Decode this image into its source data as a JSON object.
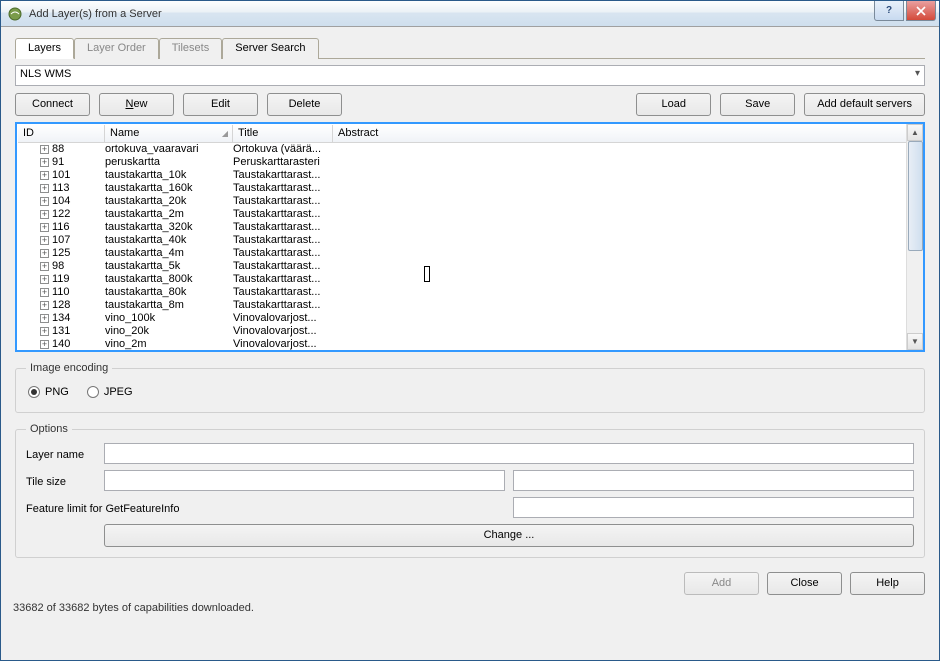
{
  "window": {
    "title": "Add Layer(s) from a Server"
  },
  "tabs": [
    {
      "label": "Layers",
      "active": true,
      "disabled": false
    },
    {
      "label": "Layer Order",
      "active": false,
      "disabled": true
    },
    {
      "label": "Tilesets",
      "active": false,
      "disabled": true
    },
    {
      "label": "Server Search",
      "active": false,
      "disabled": false
    }
  ],
  "server_dropdown": {
    "value": "NLS WMS"
  },
  "buttons": {
    "connect": "Connect",
    "new": "New",
    "edit": "Edit",
    "delete": "Delete",
    "load": "Load",
    "save": "Save",
    "add_default": "Add default servers",
    "add": "Add",
    "close": "Close",
    "help": "Help",
    "change": "Change ..."
  },
  "columns": {
    "id": "ID",
    "name": "Name",
    "title": "Title",
    "abstract": "Abstract"
  },
  "rows": [
    {
      "id": "88",
      "name": "ortokuva_vaaravari",
      "title": "Ortokuva (väärä..."
    },
    {
      "id": "91",
      "name": "peruskartta",
      "title": "Peruskarttarasteri"
    },
    {
      "id": "101",
      "name": "taustakartta_10k",
      "title": "Taustakarttarast..."
    },
    {
      "id": "113",
      "name": "taustakartta_160k",
      "title": "Taustakarttarast..."
    },
    {
      "id": "104",
      "name": "taustakartta_20k",
      "title": "Taustakarttarast..."
    },
    {
      "id": "122",
      "name": "taustakartta_2m",
      "title": "Taustakarttarast..."
    },
    {
      "id": "116",
      "name": "taustakartta_320k",
      "title": "Taustakarttarast..."
    },
    {
      "id": "107",
      "name": "taustakartta_40k",
      "title": "Taustakarttarast..."
    },
    {
      "id": "125",
      "name": "taustakartta_4m",
      "title": "Taustakarttarast..."
    },
    {
      "id": "98",
      "name": "taustakartta_5k",
      "title": "Taustakarttarast..."
    },
    {
      "id": "119",
      "name": "taustakartta_800k",
      "title": "Taustakarttarast..."
    },
    {
      "id": "110",
      "name": "taustakartta_80k",
      "title": "Taustakarttarast..."
    },
    {
      "id": "128",
      "name": "taustakartta_8m",
      "title": "Taustakarttarast..."
    },
    {
      "id": "134",
      "name": "vino_100k",
      "title": "Vinovalovarjost..."
    },
    {
      "id": "131",
      "name": "vino_20k",
      "title": "Vinovalovarjost..."
    },
    {
      "id": "140",
      "name": "vino_2m",
      "title": "Vinovalovarjost..."
    }
  ],
  "image_encoding": {
    "legend": "Image encoding",
    "png": "PNG",
    "jpeg": "JPEG",
    "selected": "PNG"
  },
  "options": {
    "legend": "Options",
    "layer_name_label": "Layer name",
    "tile_size_label": "Tile size",
    "feature_limit_label": "Feature limit for GetFeatureInfo",
    "layer_name": "",
    "tile_size_a": "",
    "tile_size_b": "",
    "feature_limit": ""
  },
  "status": "33682 of 33682 bytes of capabilities downloaded."
}
